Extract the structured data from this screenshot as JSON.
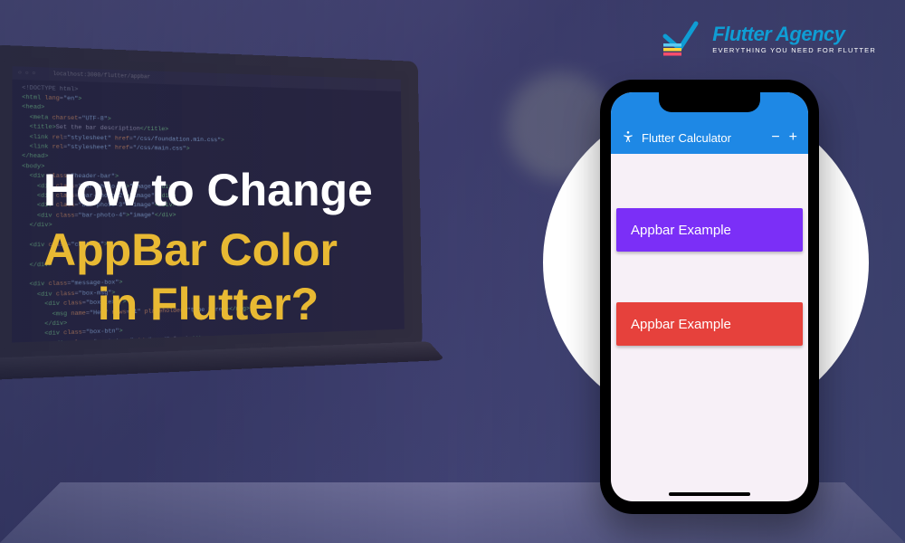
{
  "title": {
    "line1": "How to Change",
    "line2": "AppBar Color",
    "line3": "in Flutter?"
  },
  "brand": {
    "name": "Flutter Agency",
    "tagline": "EVERYTHING YOU NEED FOR FLUTTER"
  },
  "phone": {
    "appbar_title": "Flutter Calculator",
    "icon_left": "accessibility",
    "icon_minus": "−",
    "icon_plus": "+",
    "examples": [
      {
        "label": "Appbar Example",
        "color": "purple"
      },
      {
        "label": "Appbar Example",
        "color": "red"
      }
    ]
  },
  "colors": {
    "accent_yellow": "#e8b933",
    "flutter_blue": "#1e88e5",
    "purple": "#7b2ff7",
    "red": "#e6413c",
    "brand_blue": "#0f9dd4"
  }
}
